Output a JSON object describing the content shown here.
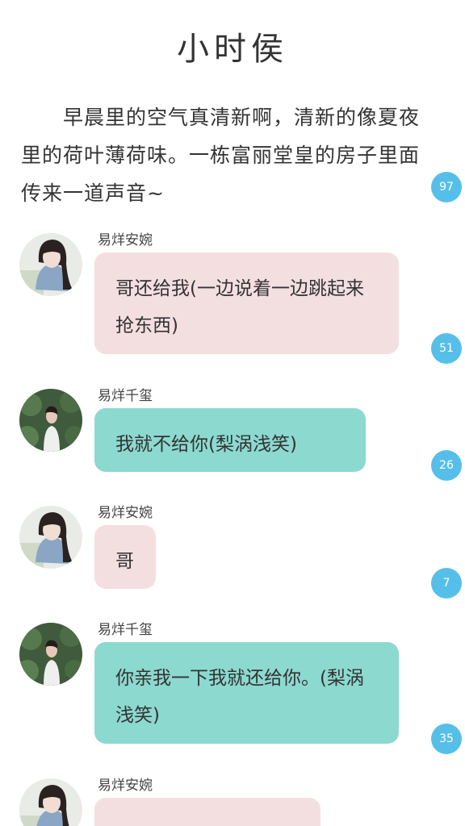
{
  "title": "小时侯",
  "intro": "早晨里的空气真清新啊，清新的像夏夜里的荷叶薄荷味。一栋富丽堂皇的房子里面传来一道声音~",
  "colors": {
    "pink_bubble": "#f4dfe0",
    "teal_bubble": "#8cd9d0",
    "badge": "#56bfe9"
  },
  "comment_counts": [
    "97",
    "51",
    "26",
    "7",
    "35"
  ],
  "messages": [
    {
      "sender": "易烊安婉",
      "text": "哥还给我(一边说着一边跳起来抢东西)",
      "bubble_color": "pink"
    },
    {
      "sender": "易烊千玺",
      "text": "我就不给你(梨涡浅笑)",
      "bubble_color": "teal"
    },
    {
      "sender": "易烊安婉",
      "text": "哥",
      "bubble_color": "pink"
    },
    {
      "sender": "易烊千玺",
      "text": "你亲我一下我就还给你。(梨涡浅笑)",
      "bubble_color": "teal"
    },
    {
      "sender": "易烊安婉",
      "text": "",
      "bubble_color": "pink"
    }
  ]
}
